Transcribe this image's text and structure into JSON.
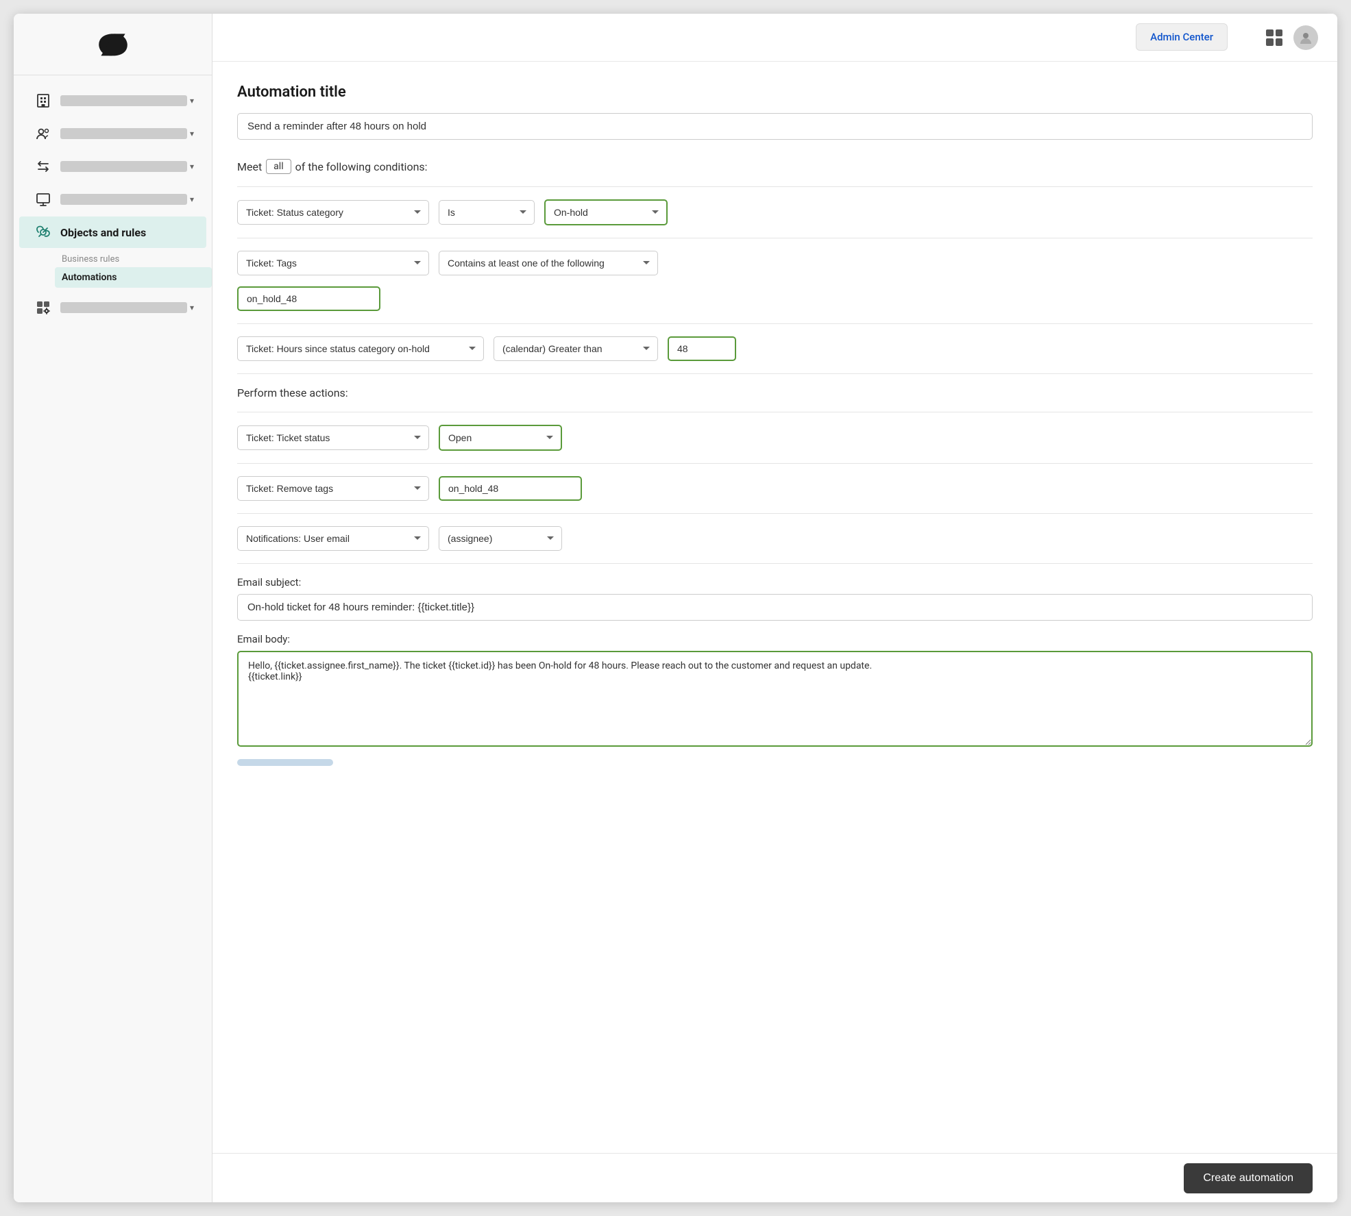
{
  "sidebar": {
    "nav_items": [
      {
        "id": "building",
        "label": "",
        "active": false,
        "icon": "building-icon"
      },
      {
        "id": "people",
        "label": "",
        "active": false,
        "icon": "people-icon"
      },
      {
        "id": "arrows",
        "label": "",
        "active": false,
        "icon": "arrows-icon"
      },
      {
        "id": "monitor",
        "label": "",
        "active": false,
        "icon": "monitor-icon"
      },
      {
        "id": "objects",
        "label": "Objects and rules",
        "active": true,
        "icon": "objects-icon"
      },
      {
        "id": "apps",
        "label": "",
        "active": false,
        "icon": "apps-icon"
      }
    ],
    "sub_nav": {
      "parent_label": "Business rules",
      "active_item": "Automations",
      "items": [
        "Automations"
      ]
    }
  },
  "topbar": {
    "admin_center_label": "Admin Center",
    "grid_icon": "grid-icon",
    "user_icon": "user-icon"
  },
  "form": {
    "title": "Automation title",
    "title_input_value": "Send a reminder after 48 hours on hold",
    "title_input_placeholder": "Send a reminder after 48 hours on hold",
    "conditions_label": "Meet",
    "all_badge": "all",
    "conditions_suffix": "of the following conditions:",
    "conditions": [
      {
        "id": "cond1",
        "field_value": "Ticket: Status category",
        "operator_value": "Is",
        "value_value": "On-hold",
        "highlighted": true
      },
      {
        "id": "cond2",
        "field_value": "Ticket: Tags",
        "operator_value": "Contains at least one of the following",
        "tag_value": "on_hold_48",
        "highlighted": true
      },
      {
        "id": "cond3",
        "field_value": "Ticket: Hours since status category on-hold",
        "operator_value": "(calendar) Greater than",
        "number_value": "48",
        "highlighted": true
      }
    ],
    "actions_label": "Perform these actions:",
    "actions": [
      {
        "id": "act1",
        "field_value": "Ticket: Ticket status",
        "value_value": "Open",
        "highlighted": true
      },
      {
        "id": "act2",
        "field_value": "Ticket: Remove tags",
        "tag_value": "on_hold_48",
        "highlighted": true
      },
      {
        "id": "act3",
        "field_value": "Notifications: User email",
        "value_value": "(assignee)",
        "highlighted": false
      }
    ],
    "email_subject_label": "Email subject:",
    "email_subject_value": "On-hold ticket for 48 hours reminder: {{ticket.title}}",
    "email_body_label": "Email body:",
    "email_body_value": "Hello, {{ticket.assignee.first_name}}. The ticket {{ticket.id}} has been On-hold for 48 hours. Please reach out to the customer and request an update.\n{{ticket.link}}"
  },
  "footer": {
    "create_button_label": "Create automation"
  }
}
